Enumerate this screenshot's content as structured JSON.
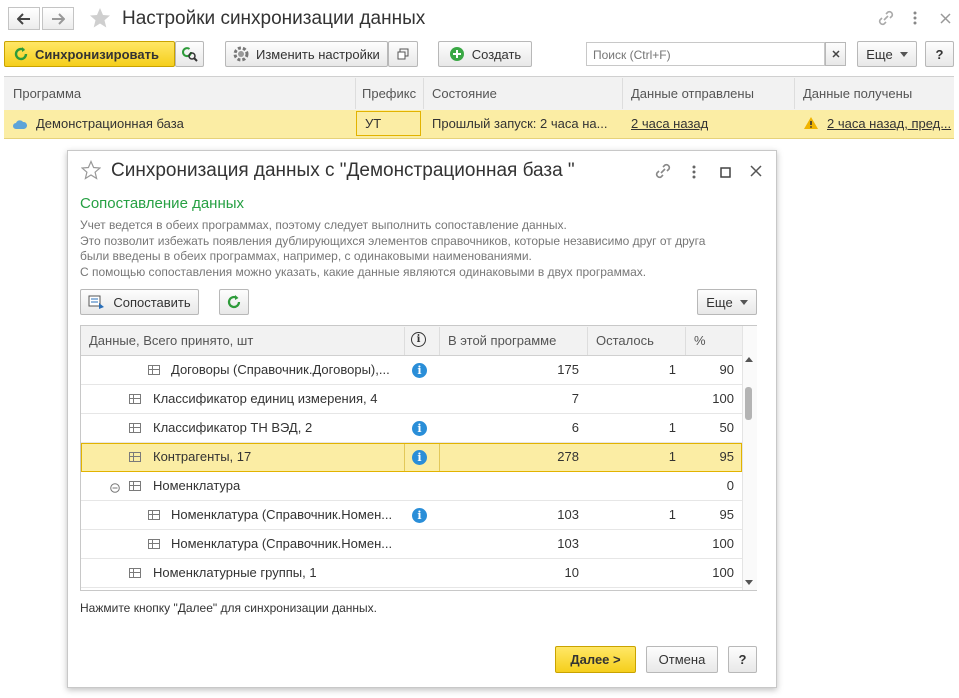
{
  "window": {
    "title": "Настройки синхронизации данных"
  },
  "toolbar": {
    "sync_label": "Синхронизировать",
    "change_settings_label": "Изменить настройки",
    "create_label": "Создать",
    "search_placeholder": "Поиск (Ctrl+F)",
    "more_label": "Еще",
    "help_label": "?"
  },
  "main_table": {
    "columns": [
      "Программа",
      "Префикс",
      "Состояние",
      "Данные отправлены",
      "Данные получены"
    ],
    "row": {
      "program": "Демонстрационная база",
      "prefix": "УТ",
      "state": "Прошлый запуск: 2 часа на...",
      "sent": "2 часа назад",
      "received": "2 часа назад, пред..."
    }
  },
  "dialog": {
    "title": "Синхронизация данных с \"Демонстрационная база \"",
    "section_title": "Сопоставление данных",
    "description": [
      "Учет ведется в обеих программах, поэтому следует выполнить сопоставление данных.",
      "Это позволит избежать появления дублирующихся элементов справочников, которые независимо друг от друга",
      "были введены в обеих программах, например, с одинаковыми наименованиями.",
      "С помощью сопоставления можно указать, какие данные являются одинаковыми в двух программах."
    ],
    "match_button": "Сопоставить",
    "more_label": "Еще",
    "grid": {
      "columns": [
        "Данные, Всего принято, шт",
        "i",
        "В этой программе",
        "Осталось",
        "%"
      ],
      "rows": [
        {
          "name": "Договоры (Справочник.Договоры),...",
          "info": true,
          "here": "175",
          "left": "1",
          "pct": "90"
        },
        {
          "name": "Классификатор единиц измерения, 4",
          "info": false,
          "here": "7",
          "left": "",
          "pct": "100"
        },
        {
          "name": "Классификатор ТН ВЭД, 2",
          "info": true,
          "here": "6",
          "left": "1",
          "pct": "50"
        },
        {
          "name": "Контрагенты, 17",
          "info": true,
          "here": "278",
          "left": "1",
          "pct": "95"
        },
        {
          "name": "Номенклатура",
          "info": false,
          "here": "",
          "left": "",
          "pct": "0"
        },
        {
          "name": "Номенклатура (Справочник.Номен...",
          "info": true,
          "here": "103",
          "left": "1",
          "pct": "95"
        },
        {
          "name": "Номенклатура (Справочник.Номен...",
          "info": false,
          "here": "103",
          "left": "",
          "pct": "100"
        },
        {
          "name": "Номенклатурные группы, 1",
          "info": false,
          "here": "10",
          "left": "",
          "pct": "100"
        }
      ]
    },
    "hint": "Нажмите кнопку \"Далее\" для синхронизации данных.",
    "next_label": "Далее >",
    "cancel_label": "Отмена",
    "help_label": "?"
  },
  "colors": {
    "accent_yellow": "#f5cf1c",
    "selected_row": "#fbeda4",
    "section_green": "#26a043",
    "link_blue": "#2a8ed8"
  }
}
